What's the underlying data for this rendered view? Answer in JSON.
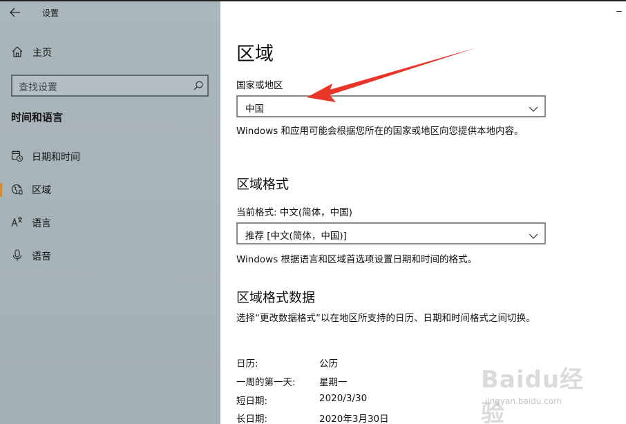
{
  "window": {
    "title": "设置"
  },
  "sidebar": {
    "home_label": "主页",
    "search_placeholder": "查找设置",
    "section_title": "时间和语言",
    "items": [
      {
        "label": "日期和时间",
        "icon": "calendar-clock-icon",
        "selected": false
      },
      {
        "label": "区域",
        "icon": "globe-region-icon",
        "selected": true
      },
      {
        "label": "语言",
        "icon": "language-icon",
        "selected": false
      },
      {
        "label": "语音",
        "icon": "microphone-icon",
        "selected": false
      }
    ],
    "accent_color": "#e08a1e"
  },
  "main": {
    "page_title": "区域",
    "country": {
      "label": "国家或地区",
      "selected": "中国",
      "description": "Windows 和应用可能会根据您所在的国家或地区向您提供本地内容。"
    },
    "format": {
      "heading": "区域格式",
      "current_label": "当前格式: 中文(简体，中国)",
      "selected": "推荐 [中文(简体，中国)]",
      "description": "Windows 根据语言和区域首选项设置日期和时间的格式。"
    },
    "format_data": {
      "heading": "区域格式数据",
      "description": "选择“更改数据格式”以在地区所支持的日历、日期和时间格式之间切换。",
      "rows": [
        {
          "key": "日历:",
          "value": "公历"
        },
        {
          "key": "一周的第一天:",
          "value": "星期一"
        },
        {
          "key": "短日期:",
          "value": "2020/3/30"
        },
        {
          "key": "长日期:",
          "value": "2020年3月30日"
        }
      ]
    }
  },
  "annotation": {
    "arrow_color": "#e8362b"
  },
  "watermark": {
    "brand": "Baidu经验",
    "url": "jingyan.baidu.com"
  }
}
